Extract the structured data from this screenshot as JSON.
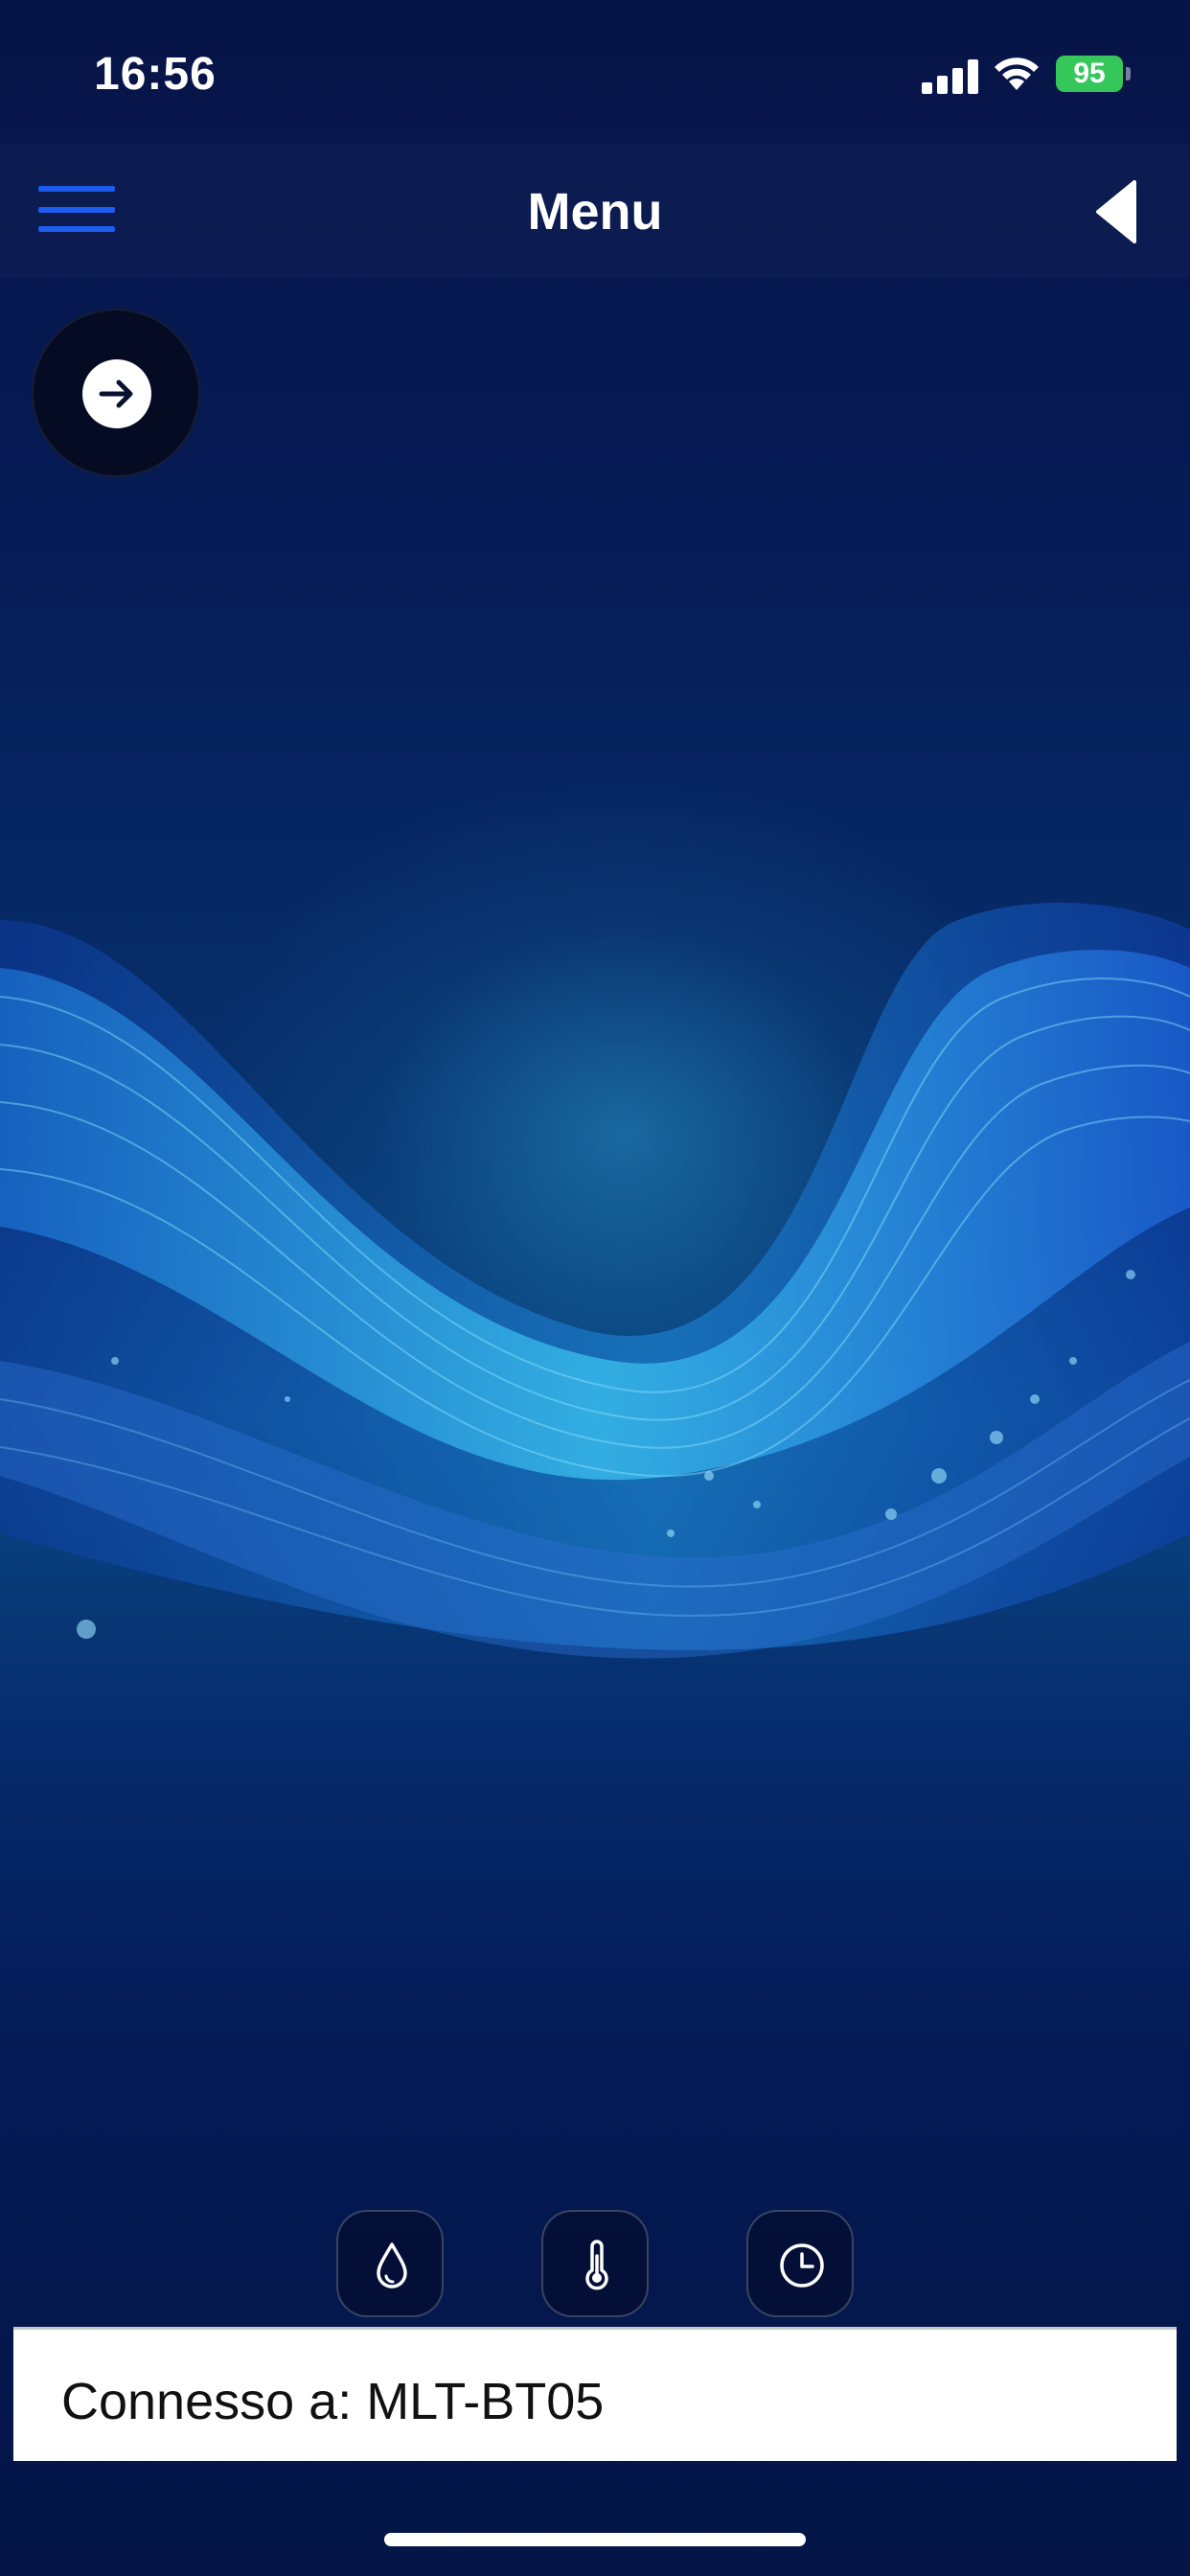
{
  "status_bar": {
    "time": "16:56",
    "battery": "95"
  },
  "nav": {
    "title": "Menu",
    "menu_icon": "hamburger-icon",
    "back_icon": "back-triangle-icon",
    "accent_color": "#1e5cf0"
  },
  "fab": {
    "icon": "arrow-right-icon"
  },
  "bottom_buttons": [
    {
      "icon": "water-drop-icon"
    },
    {
      "icon": "thermometer-icon"
    },
    {
      "icon": "clock-icon"
    }
  ],
  "connection": {
    "text": "Connesso a: MLT-BT05"
  }
}
